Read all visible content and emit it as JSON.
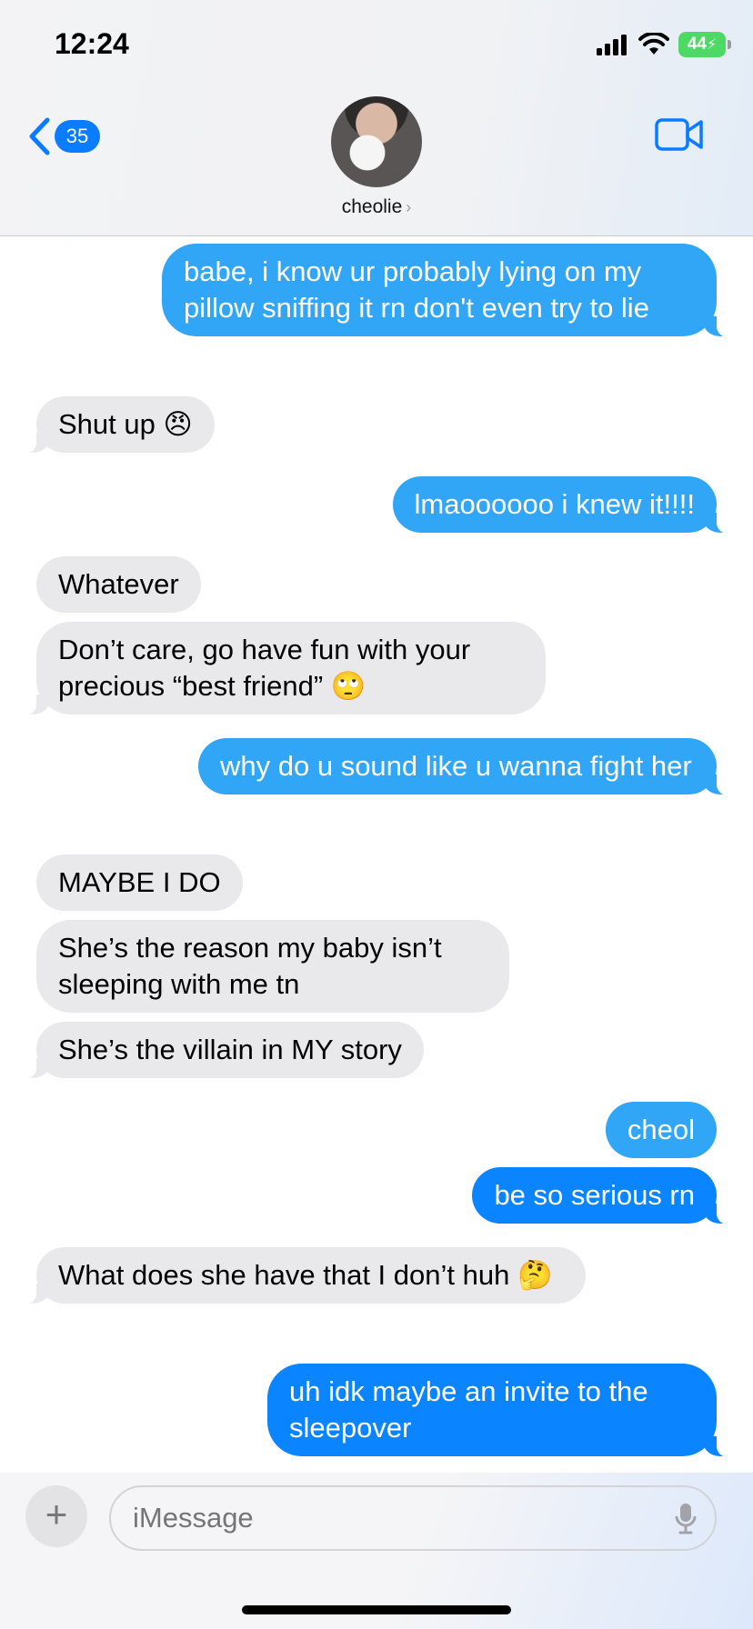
{
  "status": {
    "time": "12:24",
    "battery": "44"
  },
  "header": {
    "back_count": "35",
    "contact_name": "cheolie"
  },
  "messages": [
    {
      "from": "me",
      "text": "babe, i know ur probably lying on my pillow sniffing it rn don't even try to lie"
    },
    {
      "from": "them",
      "text": "Shut up 😠"
    },
    {
      "from": "me",
      "text": "lmaoooooo i knew it!!!!"
    },
    {
      "from": "them",
      "text": "Whatever"
    },
    {
      "from": "them",
      "text": "Don’t care, go have fun with your precious “best friend” 🙄"
    },
    {
      "from": "me",
      "text": "why do u sound like u wanna fight her"
    },
    {
      "from": "them",
      "text": "MAYBE I DO"
    },
    {
      "from": "them",
      "text": "She’s the reason my baby isn’t sleeping with me tn"
    },
    {
      "from": "them",
      "text": "She’s the villain in MY story"
    },
    {
      "from": "me",
      "text": "cheol"
    },
    {
      "from": "me",
      "text": "be so serious rn"
    },
    {
      "from": "them",
      "text": "What does she have that I don’t huh 🤔"
    },
    {
      "from": "me",
      "text": "uh idk maybe an invite to the sleepover"
    }
  ],
  "composer": {
    "placeholder": "iMessage",
    "plus": "+"
  },
  "icons": {
    "back": "chevron-left-icon",
    "video": "video-camera-icon",
    "mic": "microphone-icon",
    "signal": "cellular-signal-icon",
    "wifi": "wifi-icon"
  },
  "colors": {
    "sent": "#31a6f6",
    "sent_dark": "#0a84ff",
    "received": "#e9e9eb",
    "accent": "#0a7cff"
  }
}
